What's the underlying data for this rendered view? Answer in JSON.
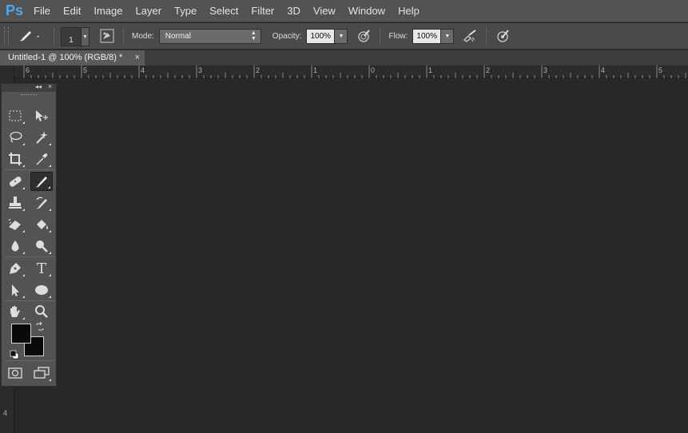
{
  "app": {
    "logo": "Ps"
  },
  "menu": [
    "File",
    "Edit",
    "Image",
    "Layer",
    "Type",
    "Select",
    "Filter",
    "3D",
    "View",
    "Window",
    "Help"
  ],
  "options": {
    "brush_size": "1",
    "mode_label": "Mode:",
    "mode_value": "Normal",
    "opacity_label": "Opacity:",
    "opacity_value": "100%",
    "flow_label": "Flow:",
    "flow_value": "100%"
  },
  "document": {
    "tab_title": "Untitled-1 @ 100% (RGB/8) *",
    "close": "×"
  },
  "ruler": {
    "h_labels": [
      "6",
      "5",
      "4",
      "3",
      "2",
      "1",
      "0",
      "1",
      "2",
      "3",
      "4",
      "5"
    ],
    "v_labels": [
      "4"
    ]
  },
  "toolbox": {
    "collapse": "◂◂",
    "close": "×",
    "tools": [
      {
        "name": "rectangular-marquee-tool"
      },
      {
        "name": "move-tool"
      },
      {
        "name": "lasso-tool"
      },
      {
        "name": "magic-wand-tool"
      },
      {
        "name": "crop-tool"
      },
      {
        "name": "eyedropper-tool"
      },
      {
        "name": "spot-healing-brush-tool"
      },
      {
        "name": "brush-tool",
        "active": true
      },
      {
        "name": "clone-stamp-tool"
      },
      {
        "name": "history-brush-tool"
      },
      {
        "name": "eraser-tool"
      },
      {
        "name": "paint-bucket-tool"
      },
      {
        "name": "blur-tool"
      },
      {
        "name": "dodge-tool"
      },
      {
        "name": "pen-tool"
      },
      {
        "name": "type-tool",
        "glyph": "T"
      },
      {
        "name": "path-selection-tool"
      },
      {
        "name": "ellipse-tool"
      },
      {
        "name": "hand-tool"
      },
      {
        "name": "zoom-tool"
      }
    ],
    "foreground_color": "#0a0a0a",
    "background_color": "#0a0a0a"
  }
}
